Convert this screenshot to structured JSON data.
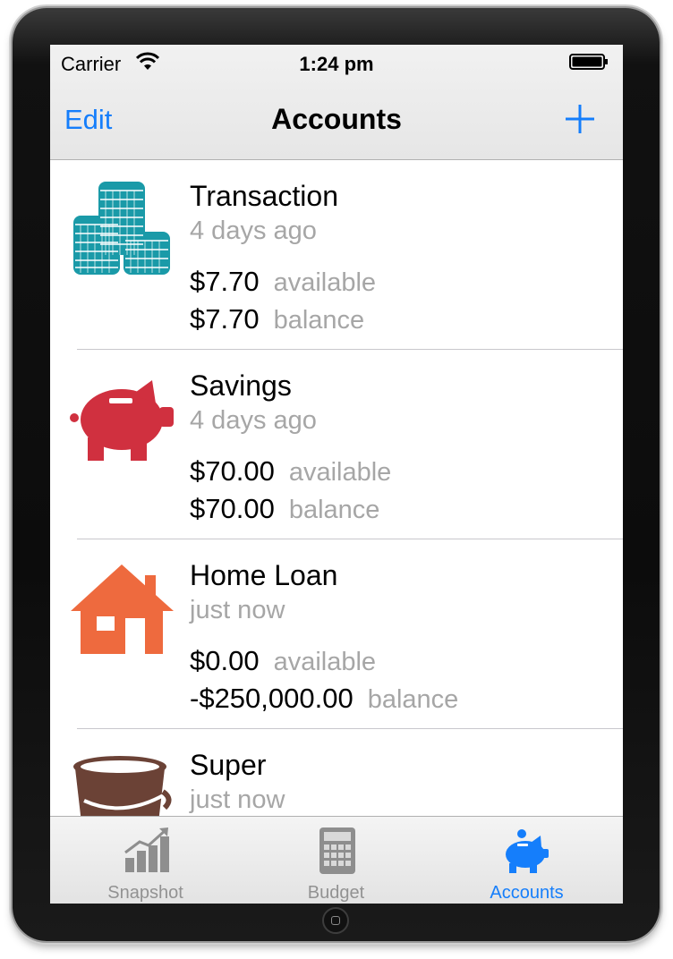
{
  "status_bar": {
    "carrier": "Carrier",
    "time": "1:24 pm"
  },
  "nav_bar": {
    "left_button": "Edit",
    "title": "Accounts",
    "right_button_icon": "plus-icon"
  },
  "accounts": [
    {
      "name": "Transaction",
      "updated": "4 days ago",
      "available": "$7.70",
      "available_label": "available",
      "balance": "$7.70",
      "balance_label": "balance",
      "icon": "coin-stacks-icon",
      "icon_color": "#1a9aa8"
    },
    {
      "name": "Savings",
      "updated": "4 days ago",
      "available": "$70.00",
      "available_label": "available",
      "balance": "$70.00",
      "balance_label": "balance",
      "icon": "piggy-bank-icon",
      "icon_color": "#d0303f"
    },
    {
      "name": "Home Loan",
      "updated": "just now",
      "available": "$0.00",
      "available_label": "available",
      "balance": "-$250,000.00",
      "balance_label": "balance",
      "icon": "house-icon",
      "icon_color": "#ee6a3e"
    },
    {
      "name": "Super",
      "updated": "just now",
      "icon": "bucket-icon",
      "icon_color": "#6b4236"
    }
  ],
  "tab_bar": {
    "tabs": [
      {
        "label": "Snapshot",
        "icon": "chart-icon",
        "active": false
      },
      {
        "label": "Budget",
        "icon": "calculator-icon",
        "active": false
      },
      {
        "label": "Accounts",
        "icon": "piggy-bank-icon",
        "active": true
      }
    ]
  },
  "colors": {
    "accent": "#157efb",
    "secondary_text": "#a6a6a6",
    "tab_inactive": "#929292"
  }
}
